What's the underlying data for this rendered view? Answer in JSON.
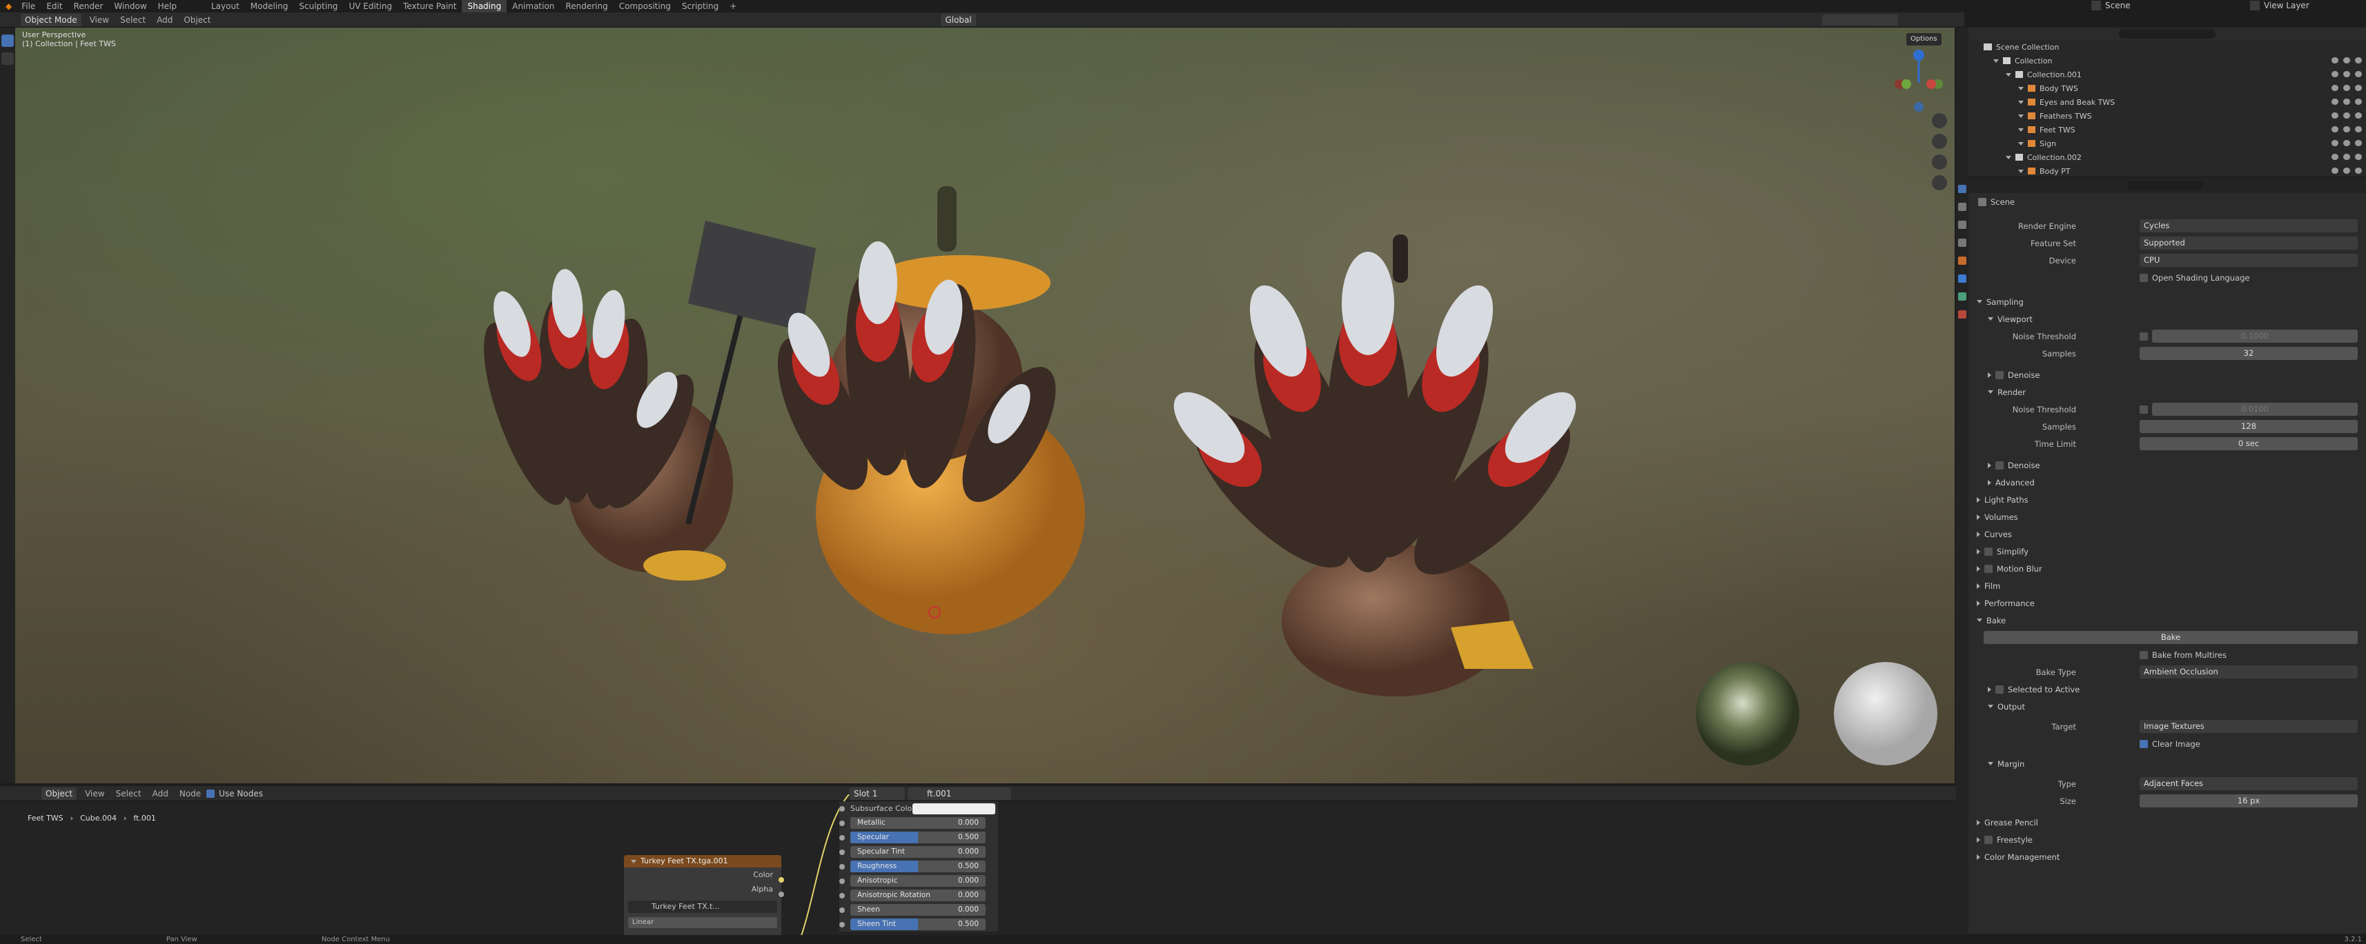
{
  "menu": [
    "File",
    "Edit",
    "Render",
    "Window",
    "Help"
  ],
  "workspaces": [
    "Layout",
    "Modeling",
    "Sculpting",
    "UV Editing",
    "Texture Paint",
    "Shading",
    "Animation",
    "Rendering",
    "Compositing",
    "Scripting"
  ],
  "active_workspace": "Shading",
  "add_workspace": "+",
  "scene_name": "Scene",
  "view_layer": "View Layer",
  "viewport_header": {
    "mode": "Object Mode",
    "menus": [
      "View",
      "Select",
      "Add",
      "Object"
    ],
    "transform": "Global",
    "options": "Options"
  },
  "viewport": {
    "title": "User Perspective",
    "subtitle": "(1) Collection | Feet TWS"
  },
  "outliner": {
    "root": "Scene Collection",
    "rows": [
      {
        "label": "Collection",
        "indent": 0
      },
      {
        "label": "Collection.001",
        "indent": 1
      },
      {
        "label": "Body TWS",
        "indent": 2
      },
      {
        "label": "Eyes and Beak TWS",
        "indent": 2
      },
      {
        "label": "Feathers TWS",
        "indent": 2
      },
      {
        "label": "Feet TWS",
        "indent": 2
      },
      {
        "label": "Sign",
        "indent": 2
      },
      {
        "label": "Collection.002",
        "indent": 1
      },
      {
        "label": "Body PT",
        "indent": 2
      }
    ]
  },
  "properties": {
    "title": "Scene",
    "render_engine_label": "Render Engine",
    "render_engine": "Cycles",
    "feature_set_label": "Feature Set",
    "feature_set": "Supported",
    "device_label": "Device",
    "device": "CPU",
    "osl": "Open Shading Language",
    "sampling": "Sampling",
    "viewport": "Viewport",
    "noise_threshold_label": "Noise Threshold",
    "vp_noise": "0.1000",
    "samples_label": "Samples",
    "vp_samples": "32",
    "denoise": "Denoise",
    "render": "Render",
    "r_noise": "0.0100",
    "r_samples": "128",
    "time_limit_label": "Time Limit",
    "time_limit": "0 sec",
    "advanced": "Advanced",
    "sections_a": [
      "Light Paths",
      "Volumes",
      "Curves",
      "Simplify",
      "Motion Blur",
      "Film",
      "Performance"
    ],
    "bake": "Bake",
    "bake_button": "Bake",
    "bake_multires": "Bake from Multires",
    "bake_type_label": "Bake Type",
    "bake_type": "Ambient Occlusion",
    "selected_to_active": "Selected to Active",
    "output": "Output",
    "target_label": "Target",
    "target": "Image Textures",
    "clear_image": "Clear Image",
    "margin": "Margin",
    "type_label": "Type",
    "margin_type": "Adjacent Faces",
    "size_label": "Size",
    "margin_size": "16 px",
    "sections_b": [
      "Grease Pencil",
      "Freestyle",
      "Color Management"
    ]
  },
  "node_header": {
    "mode": "Object",
    "menus": [
      "View",
      "Select",
      "Add",
      "Node"
    ],
    "use_nodes": "Use Nodes",
    "slot": "Slot 1",
    "material": "ft.001"
  },
  "breadcrumb": {
    "object": "Feet TWS",
    "mesh": "Cube.004",
    "material": "ft.001"
  },
  "image_node": {
    "title": "Turkey Feet TX.tga.001",
    "out1": "Color",
    "out2": "Alpha",
    "image": "Turkey Feet TX.t...",
    "interp": "Linear"
  },
  "bsdf_rows": [
    {
      "name": "Subsurface Colo",
      "value": "",
      "frac": 0
    },
    {
      "name": "Metallic",
      "value": "0.000",
      "frac": 0
    },
    {
      "name": "Specular",
      "value": "0.500",
      "frac": 0.5
    },
    {
      "name": "Specular Tint",
      "value": "0.000",
      "frac": 0
    },
    {
      "name": "Roughness",
      "value": "0.500",
      "frac": 0.5
    },
    {
      "name": "Anisotropic",
      "value": "0.000",
      "frac": 0
    },
    {
      "name": "Anisotropic Rotation",
      "value": "0.000",
      "frac": 0
    },
    {
      "name": "Sheen",
      "value": "0.000",
      "frac": 0
    },
    {
      "name": "Sheen Tint",
      "value": "0.500",
      "frac": 0.5
    }
  ],
  "status": {
    "select": "Select",
    "pan": "Pan View",
    "context": "Node Context Menu",
    "version": "3.2.1"
  }
}
